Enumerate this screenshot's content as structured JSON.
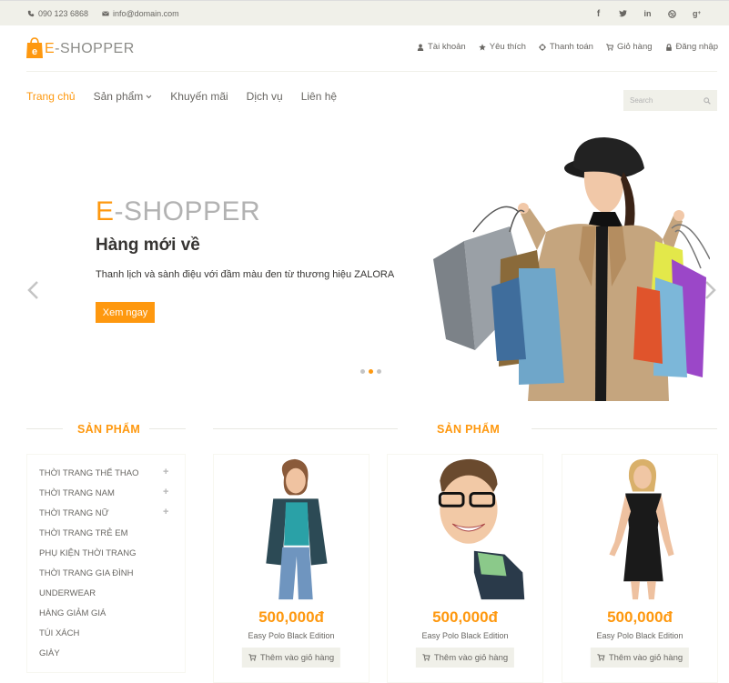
{
  "topbar": {
    "phone": "090 123 6868",
    "email": "info@domain.com",
    "socials": [
      "facebook-icon",
      "twitter-icon",
      "linkedin-icon",
      "dribbble-icon",
      "google-plus-icon"
    ]
  },
  "logo": {
    "e": "E",
    "rest": "-SHOPPER"
  },
  "usermenu": [
    {
      "label": "Tài khoản",
      "icon": "user-icon"
    },
    {
      "label": "Yêu thích",
      "icon": "star-icon"
    },
    {
      "label": "Thanh toán",
      "icon": "crosshairs-icon"
    },
    {
      "label": "Giỏ hàng",
      "icon": "cart-icon"
    },
    {
      "label": "Đăng nhập",
      "icon": "lock-icon"
    }
  ],
  "nav": [
    {
      "label": "Trang chủ",
      "active": true
    },
    {
      "label": "Sản phẩm",
      "dropdown": true
    },
    {
      "label": "Khuyến mãi"
    },
    {
      "label": "Dịch vụ"
    },
    {
      "label": "Liên hệ"
    }
  ],
  "search": {
    "placeholder": "Search"
  },
  "slider": {
    "title_e": "E",
    "title_rest": "-SHOPPER",
    "subtitle": "Hàng mới về",
    "description": "Thanh lịch và sành điệu với đầm màu đen từ thương hiệu ZALORA",
    "button": "Xem ngay"
  },
  "sidebar": {
    "title": "SẢN PHẨM",
    "categories": [
      {
        "label": "Thời trang thể thao",
        "expandable": true
      },
      {
        "label": "Thời trang nam",
        "expandable": true
      },
      {
        "label": "Thời trang nữ",
        "expandable": true
      },
      {
        "label": "Thời trang trẻ em"
      },
      {
        "label": "Phụ kiện thời trang"
      },
      {
        "label": "Thời trang gia đình"
      },
      {
        "label": "Underwear"
      },
      {
        "label": "Hàng giảm giá"
      },
      {
        "label": "Túi xách"
      },
      {
        "label": "Giày"
      }
    ]
  },
  "products_section": {
    "title": "SẢN PHẨM",
    "items": [
      {
        "price": "500,000đ",
        "name": "Easy Polo Black Edition",
        "button": "Thêm vào giỏ hàng"
      },
      {
        "price": "500,000đ",
        "name": "Easy Polo Black Edition",
        "button": "Thêm vào giỏ hàng"
      },
      {
        "price": "500,000đ",
        "name": "Easy Polo Black Edition",
        "button": "Thêm vào giỏ hàng"
      }
    ]
  },
  "colors": {
    "accent": "#fe980f",
    "bar": "#f0f0e9",
    "text": "#696763"
  }
}
